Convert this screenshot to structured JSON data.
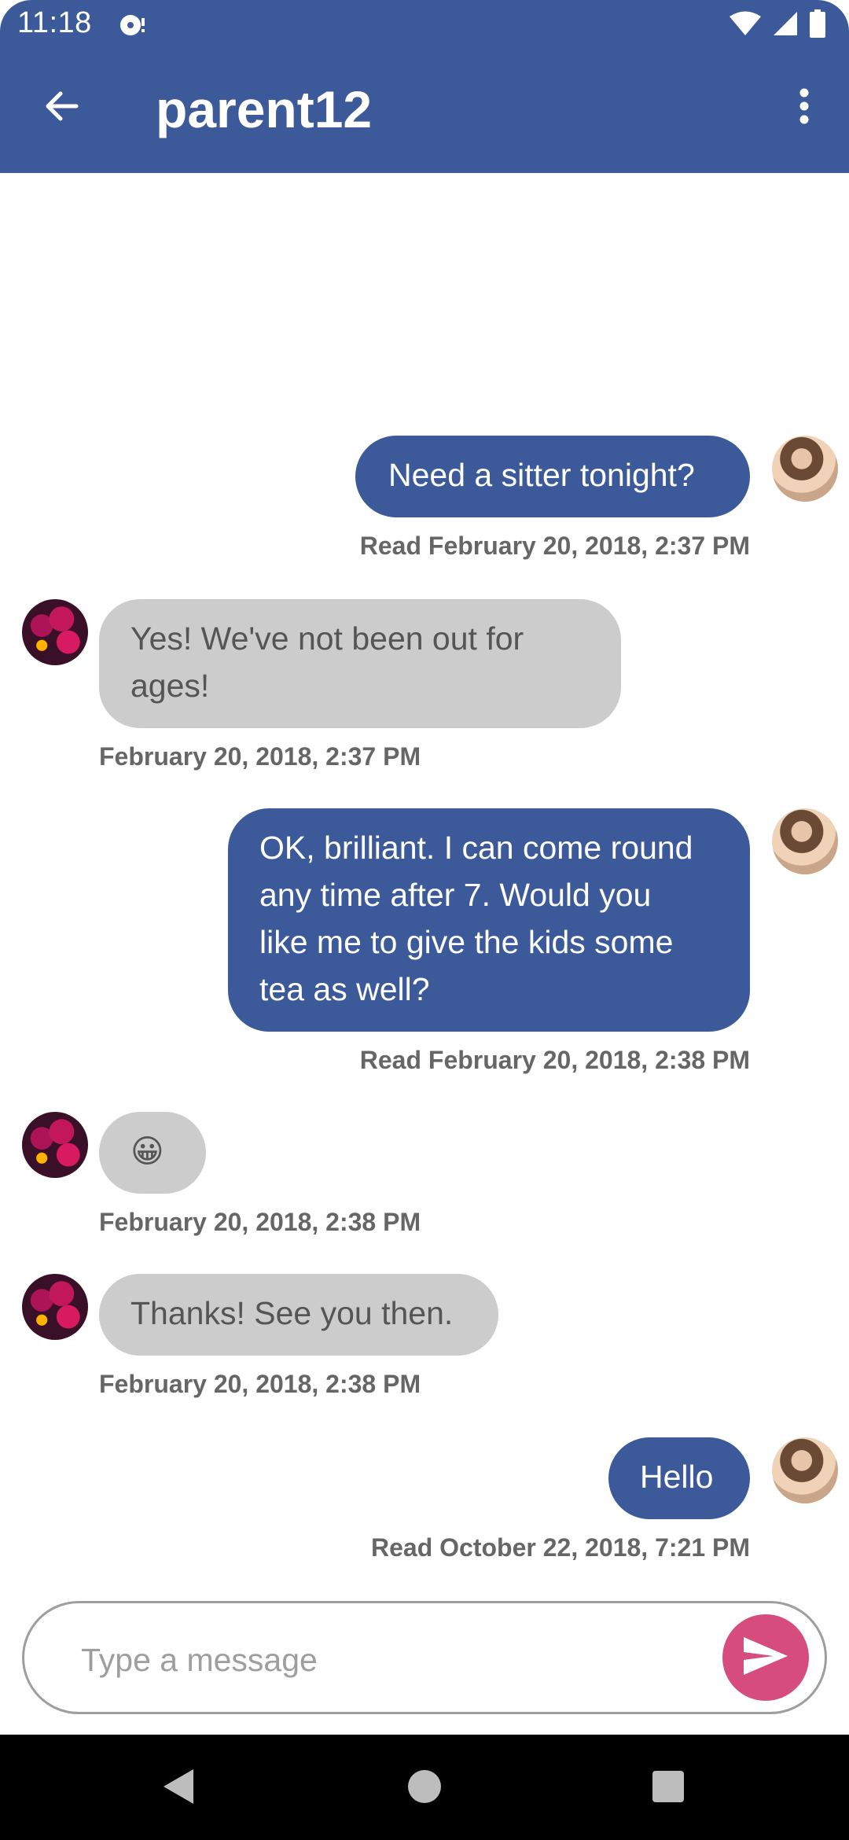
{
  "status_bar": {
    "time": "11:18"
  },
  "toolbar": {
    "title": "parent12"
  },
  "colors": {
    "primary": "#3c5a99",
    "incoming_bubble": "#cccccc",
    "send_accent": "#d64d7d"
  },
  "messages": [
    {
      "direction": "out",
      "text": "Need a sitter tonight?",
      "meta": "Read February 20, 2018, 2:37 PM"
    },
    {
      "direction": "in",
      "lines": [
        "Yes! We've not been out for",
        "ages!"
      ],
      "meta": "February 20, 2018, 2:37 PM"
    },
    {
      "direction": "out",
      "lines": [
        "OK, brilliant. I can come round",
        "any time after 7. Would you",
        "like me to give the kids some",
        "tea as well?"
      ],
      "meta": "Read February 20, 2018, 2:38 PM"
    },
    {
      "direction": "in",
      "text": "😀",
      "meta": "February 20, 2018, 2:38 PM"
    },
    {
      "direction": "in",
      "text": "Thanks! See you then.",
      "meta": "February 20, 2018, 2:38 PM"
    },
    {
      "direction": "out",
      "text": "Hello",
      "meta": "Read October 22, 2018, 7:21 PM"
    }
  ],
  "composer": {
    "placeholder": "Type a message",
    "value": ""
  },
  "icons": {
    "back": "arrow-left-icon",
    "overflow": "more-vert-icon",
    "send": "send-icon",
    "nav_back": "triangle-back-icon",
    "nav_home": "circle-home-icon",
    "nav_recents": "square-recents-icon"
  }
}
